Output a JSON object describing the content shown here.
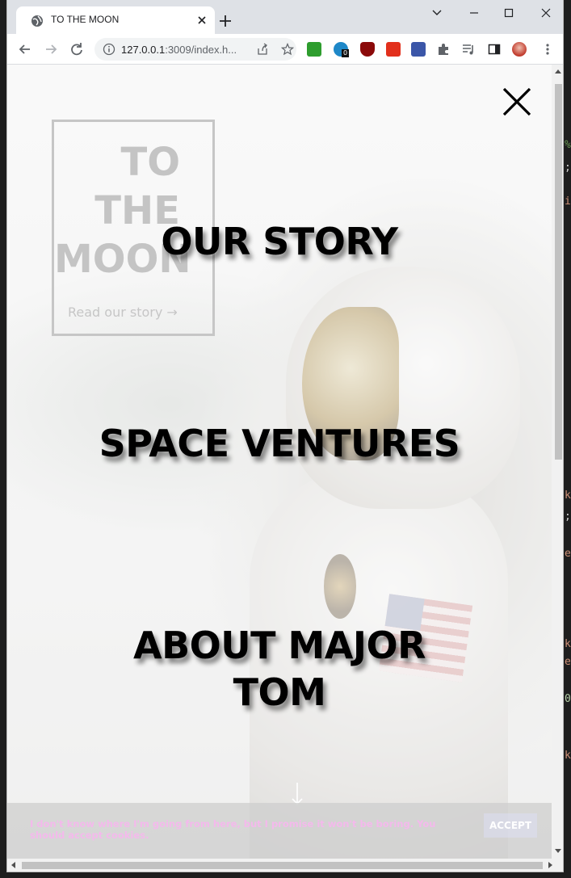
{
  "browser": {
    "tab_title": "TO THE MOON",
    "url_host": "127.0.0.1",
    "url_rest": ":3009/index.h...",
    "extension_badge": "0"
  },
  "page": {
    "logo_lines": [
      "TO",
      "THE",
      "MOON"
    ],
    "read_link": "Read our story →",
    "menu": [
      {
        "label": "OUR STORY"
      },
      {
        "label": "SPACE VENTURES"
      },
      {
        "label": "ABOUT MAJOR TOM"
      }
    ],
    "cookie_text": "I don't know where I'm going from here, but I promise it won't be boring. You should accept cookies.",
    "cookie_button": "ACCEPT"
  },
  "colors": {
    "cookie_text": "#f4b9ec",
    "menu_text": "#000000"
  }
}
